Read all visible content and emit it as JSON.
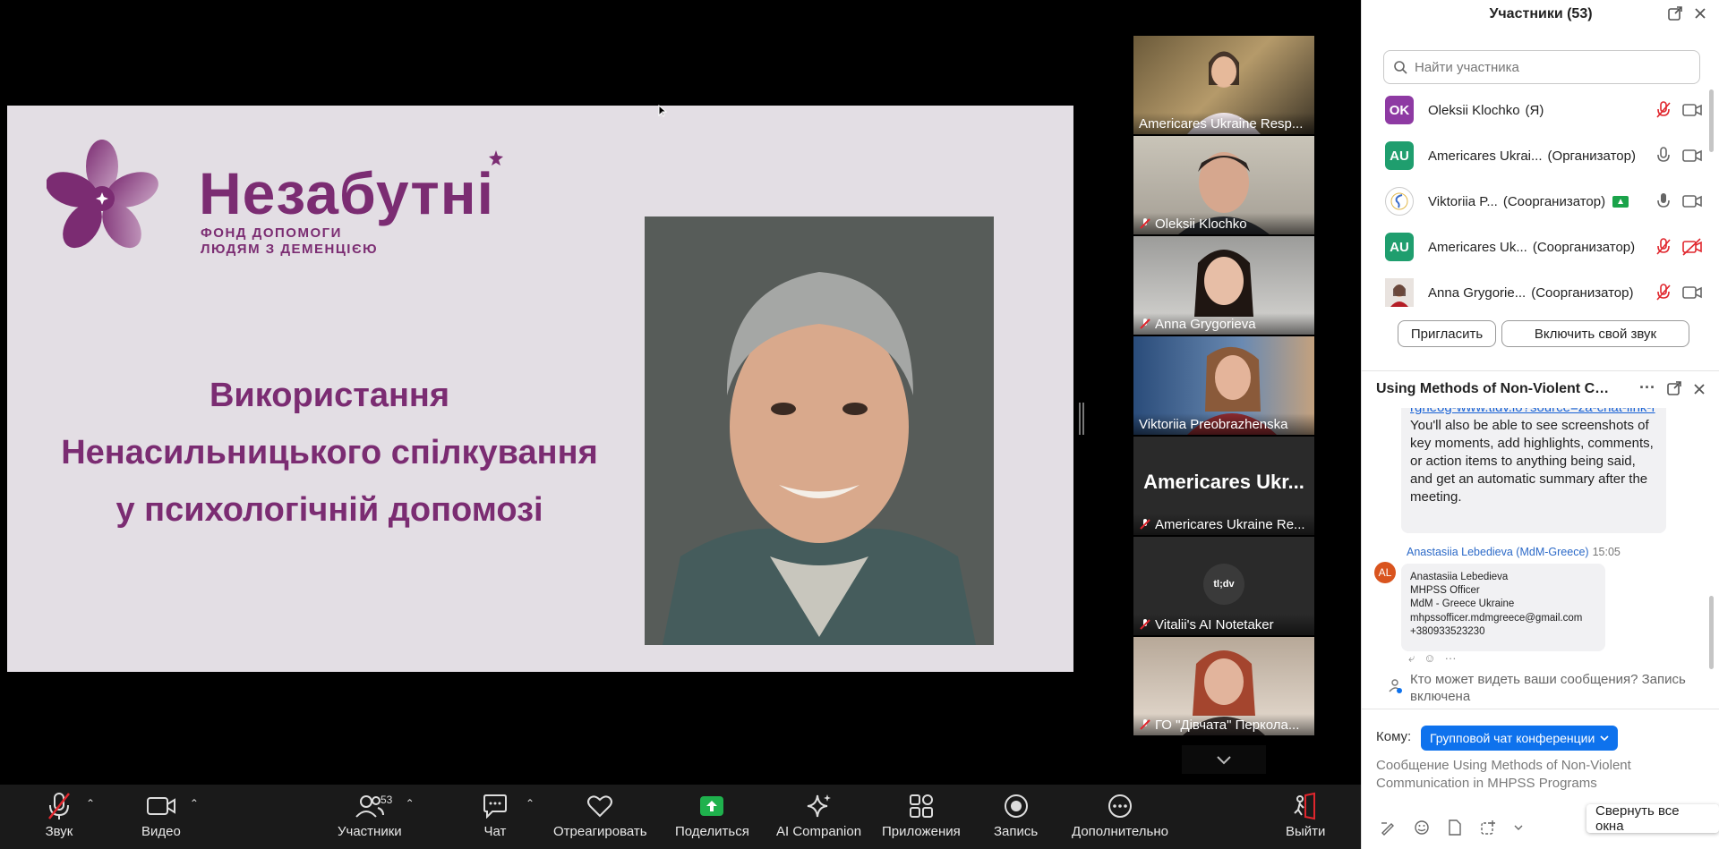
{
  "slide": {
    "logo_word": "Незабутні",
    "logo_sub_1": "ФОНД ДОПОМОГИ",
    "logo_sub_2": "ЛЮДЯМ З ДЕМЕНЦІЄЮ",
    "title_1": "Використання",
    "title_2": "Ненасильницького спілкування",
    "title_3": "у психологічній допомозі"
  },
  "gallery": {
    "tiles": [
      {
        "name": "Americares Ukraine Resp...",
        "muted": false
      },
      {
        "name": "Oleksii Klochko",
        "muted": true
      },
      {
        "name": "Anna Grygorieva",
        "muted": true,
        "active": true
      },
      {
        "name": "Viktoriia Preobrazhenska",
        "muted": false
      },
      {
        "name": "Americares Ukraine Re...",
        "big_name": "Americares Ukr...",
        "muted": true
      },
      {
        "name": "Vitalii's AI Notetaker",
        "logo_text": "tl;dv",
        "muted": true
      },
      {
        "name": "ГО \"Дівчата\" Перкола...",
        "muted": true
      }
    ]
  },
  "toolbar": {
    "audio": "Звук",
    "video": "Видео",
    "participants": "Участники",
    "participants_count": "53",
    "chat": "Чат",
    "react": "Отреагировать",
    "share": "Поделиться",
    "ai": "AI Companion",
    "apps": "Приложения",
    "record": "Запись",
    "more": "Дополнительно",
    "leave": "Выйти"
  },
  "participants_panel": {
    "title": "Участники (53)",
    "search_placeholder": "Найти участника",
    "rows": [
      {
        "initials": "OK",
        "color": "#8e3aa3",
        "name": "Oleksii Klochko",
        "role": "(Я)"
      },
      {
        "initials": "AU",
        "color": "#1f9e6e",
        "name": "Americares Ukrai...",
        "role": "(Организатор)"
      },
      {
        "initials": "",
        "color": "#ffffff",
        "name": "Viktoriia P...",
        "role": "(Соорганизатор)"
      },
      {
        "initials": "AU",
        "color": "#1f9e6e",
        "name": "Americares Uk...",
        "role": "(Соорганизатор)"
      },
      {
        "initials": "",
        "color": "#7a2020",
        "name": "Anna Grygorie...",
        "role": "(Соорганизатор)"
      }
    ],
    "invite": "Пригласить",
    "unmute_self": "Включить свой звук"
  },
  "chat": {
    "title": "Using Methods of Non-Violent Co...",
    "msg1_link": "rgneog-www.tldv.io?source=za-chat-link-f",
    "msg1_text": "You'll also be able to see screenshots of key moments, add highlights, comments, or action items to anything being said, and get an automatic summary after the meeting.",
    "sender": "Anastasiia Lebedieva (MdM-Greece)",
    "time": "15:05",
    "sender_initials": "AL",
    "msg2_lines": [
      "Anastasiia Lebedieva",
      "MHPSS Officer",
      "MdM - Greece Ukraine",
      "mhpssofficer.mdmgreece@gmail.com",
      "+380933523230"
    ],
    "privacy": "Кто может видеть ваши сообщения? Запись включена",
    "to_label": "Кому:",
    "to_value": "Групповой чат конференции",
    "compose_placeholder": "Сообщение Using Methods of Non-Violent Communication in MHPSS Programs",
    "collapse": "Свернуть все окна"
  }
}
